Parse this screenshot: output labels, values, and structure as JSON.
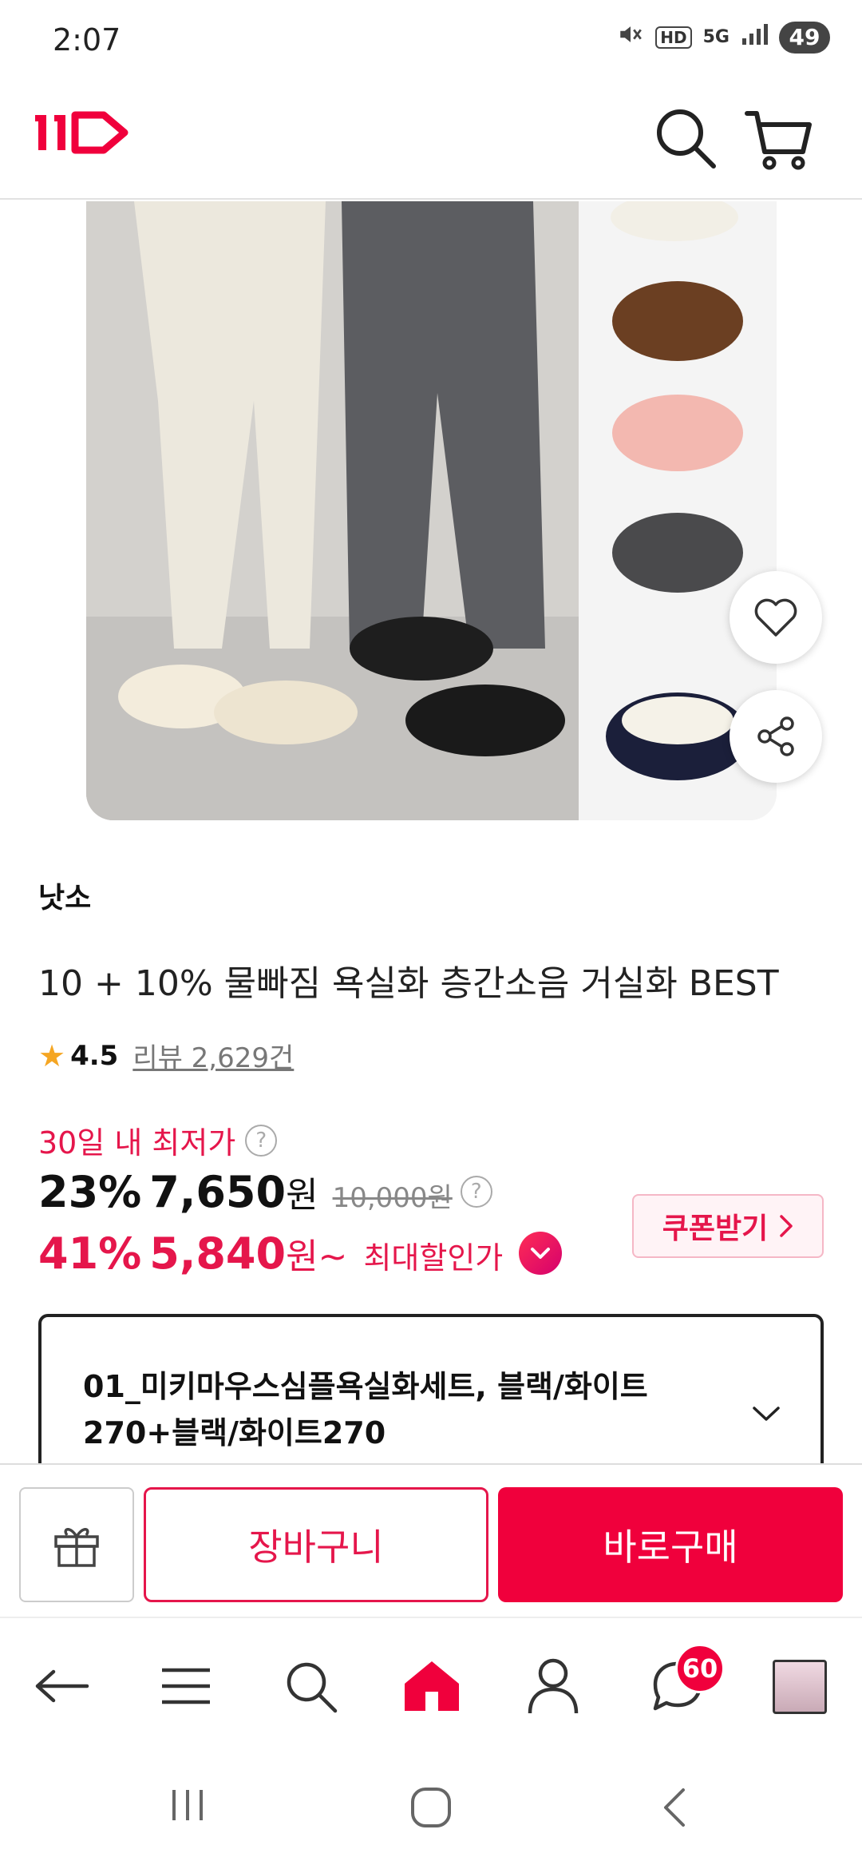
{
  "status_bar": {
    "time": "2:07",
    "battery": "49",
    "network": "5G",
    "hd": "HD"
  },
  "header": {
    "logo_text": "11",
    "brand_color": "#f0003c"
  },
  "product": {
    "seller": "낫소",
    "title": "10 + 10% 물빠짐 욕실화 층간소음 거실화 BEST",
    "rating": "4.5",
    "reviews": "리뷰 2,629건",
    "lowest_label": "30일 내 최저가",
    "discount_pct": "23%",
    "sale_price": "7,650",
    "won": "원",
    "original_price": "10,000원",
    "max_discount_pct": "41%",
    "max_price": "5,840",
    "max_won": "원~",
    "max_label": "최대할인가",
    "coupon_label": "쿠폰받기"
  },
  "option": {
    "text": "01_미키마우스심플욕실화세트, 블랙/화이트270+블랙/화이트270"
  },
  "buy_bar": {
    "cart_label": "장바구니",
    "buy_label": "바로구매"
  },
  "bottom_nav": {
    "chat_badge": "60"
  }
}
